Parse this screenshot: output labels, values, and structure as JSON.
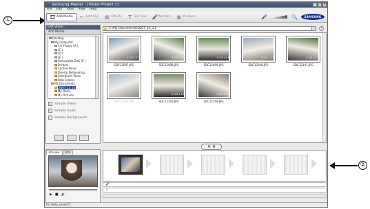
{
  "window": {
    "title": "Samsung Master - [Video Project 1]"
  },
  "menu": [
    "File",
    "Edit",
    "Tools",
    "View",
    "Help"
  ],
  "toolbar": {
    "buttons": [
      {
        "label": "Add Media",
        "icon": "add-media-icon"
      },
      {
        "label": "Edit Clip",
        "icon": "edit-clip-icon"
      },
      {
        "label": "Effects",
        "icon": "effects-icon"
      },
      {
        "label": "Set Text",
        "icon": "set-text-icon"
      },
      {
        "label": "Narrate",
        "icon": "narrate-icon"
      },
      {
        "label": "Produce",
        "icon": "produce-icon"
      }
    ],
    "brand": "SAMSUNG"
  },
  "left_panel": {
    "header": "Edit Video",
    "subheader": "Add Media",
    "tree": [
      "Desktop",
      "My Computer",
      "3½ Floppy (A:)",
      "(C:)",
      "(D:)",
      "(E:)",
      "Removable Disk (F:)",
      "Printers",
      "Control Panel",
      "Dial-Up Networking",
      "Scheduled Tasks",
      "Web Folders",
      "My Documents",
      "2007_12_21",
      "My Music",
      "My Pictures"
    ],
    "samples": [
      "Sample Video",
      "Sample Audio",
      "Sample Backgrounds"
    ]
  },
  "path": "C:\\My Documents\\2007_12_21",
  "thumbnails": [
    {
      "name": "SDC12097.JPG",
      "meta": "$ 1/1 ♯ 2.0"
    },
    {
      "name": "SDC12098.JPG",
      "meta": "$ 1/4 ♯ 2.8"
    },
    {
      "name": "SDC12099.JPG",
      "meta": "$ 1/4 ♯ 2.8"
    },
    {
      "name": "SDC12100.JPG",
      "meta": "$ 1/4 ♯ 2.8"
    },
    {
      "name": "SDC12101.JPG",
      "meta": "$ 1/4 ♯ 2.8"
    },
    {
      "name": "SDC12102.JPG",
      "meta": ""
    },
    {
      "name": "SDC12103.JPG",
      "meta": "$ 1/4 ♯ 2.8"
    },
    {
      "name": "SDC12104.JPG",
      "meta": "$ 1/4 ♯ 2.8"
    }
  ],
  "preview": {
    "tabs": [
      "Preview",
      "Info"
    ]
  },
  "status": "For Help, press F1",
  "callouts": [
    "①",
    "②"
  ]
}
